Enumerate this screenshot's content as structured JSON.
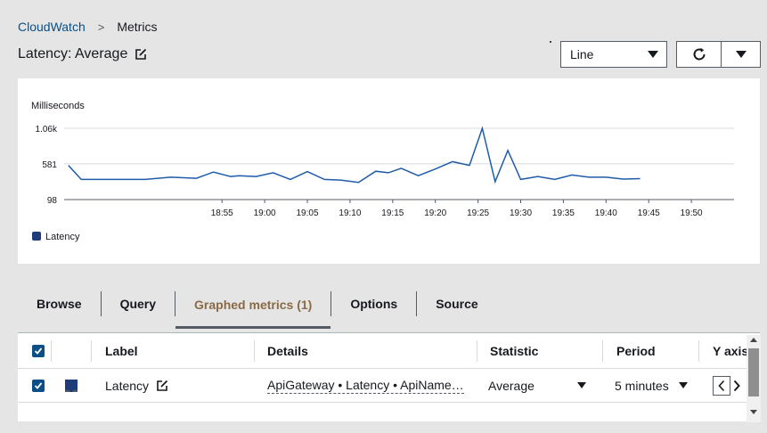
{
  "breadcrumb": {
    "parent": "CloudWatch",
    "separator": ">",
    "current": "Metrics"
  },
  "title": "Latency: Average",
  "view_select": {
    "value": "Line"
  },
  "tabs": [
    {
      "label": "Browse",
      "active": false
    },
    {
      "label": "Query",
      "active": false
    },
    {
      "label": "Graphed metrics (1)",
      "active": true
    },
    {
      "label": "Options",
      "active": false
    },
    {
      "label": "Source",
      "active": false
    }
  ],
  "table": {
    "headers": {
      "label": "Label",
      "details": "Details",
      "statistic": "Statistic",
      "period": "Period",
      "yaxis": "Y axis"
    },
    "rows": [
      {
        "label": "Latency",
        "details": "ApiGateway • Latency • ApiName…",
        "statistic": "Average",
        "period": "5 minutes"
      }
    ]
  },
  "colors": {
    "series": "#1f5ba8",
    "accent": "#0b4f86",
    "active_tab": "#8a6a45"
  },
  "chart_data": {
    "type": "line",
    "ylabel": "Milliseconds",
    "y_ticks": [
      98,
      581,
      1060
    ],
    "y_tick_labels": [
      "98",
      "581",
      "1.06k"
    ],
    "ylim": [
      98,
      1060
    ],
    "x_tick_labels": [
      "18:55",
      "19:00",
      "19:05",
      "19:10",
      "19:15",
      "19:20",
      "19:25",
      "19:30",
      "19:35",
      "19:40",
      "19:45",
      "19:50"
    ],
    "x_range_minutes": [
      -18.5,
      60
    ],
    "legend": "bottom-left",
    "series": [
      {
        "name": "Latency",
        "x": [
          -18,
          -16.5,
          -14,
          -12,
          -9,
          -6,
          -3,
          -1,
          1,
          2,
          4,
          6,
          8,
          10,
          12,
          14,
          16,
          18,
          19.5,
          21,
          23,
          25,
          27,
          29,
          30.5,
          32,
          33.5,
          35,
          37,
          39,
          41,
          43,
          45,
          47,
          49
        ],
        "values": [
          560,
          370,
          370,
          370,
          370,
          400,
          385,
          470,
          410,
          420,
          410,
          460,
          370,
          475,
          370,
          360,
          330,
          480,
          460,
          520,
          420,
          510,
          610,
          560,
          1060,
          340,
          760,
          370,
          410,
          370,
          430,
          400,
          400,
          375,
          380
        ]
      }
    ]
  }
}
